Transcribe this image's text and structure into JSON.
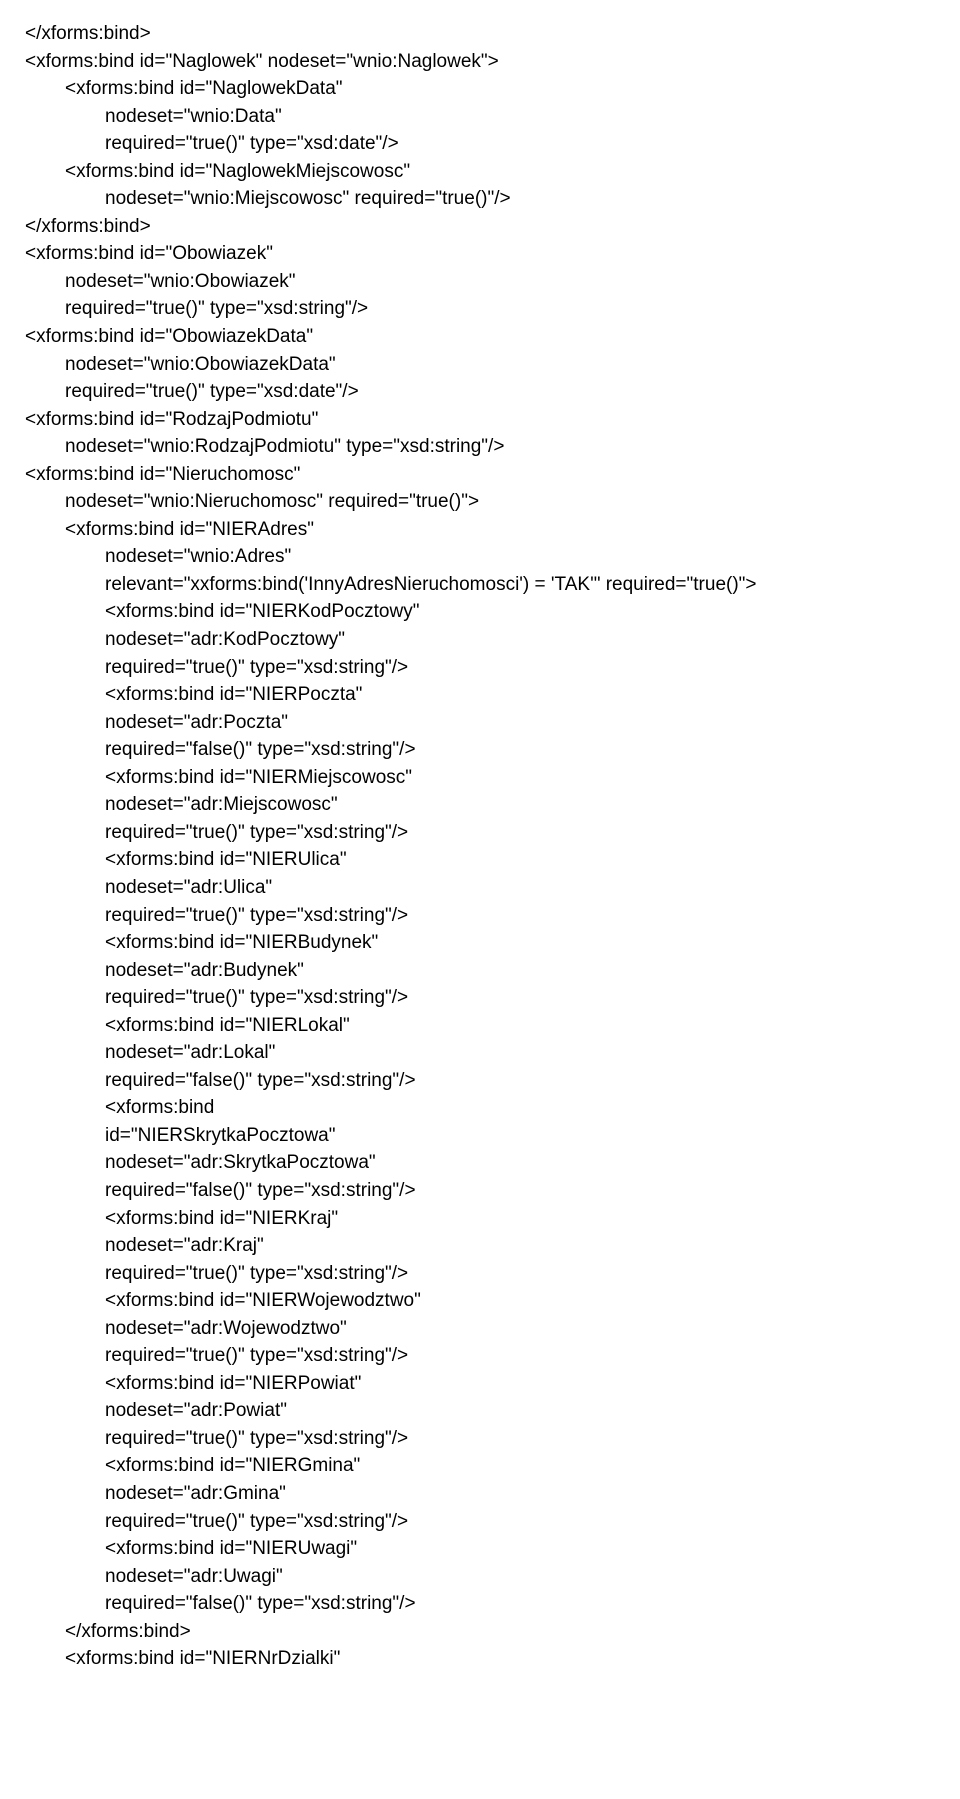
{
  "lines": [
    {
      "indent": 0,
      "text": "</xforms:bind>"
    },
    {
      "indent": 0,
      "text": "<xforms:bind id=\"Naglowek\" nodeset=\"wnio:Naglowek\">"
    },
    {
      "indent": 1,
      "text": "<xforms:bind id=\"NaglowekData\""
    },
    {
      "indent": 2,
      "text": "nodeset=\"wnio:Data\""
    },
    {
      "indent": 2,
      "text": "required=\"true()\" type=\"xsd:date\"/>"
    },
    {
      "indent": 1,
      "text": "<xforms:bind id=\"NaglowekMiejscowosc\""
    },
    {
      "indent": 2,
      "text": "nodeset=\"wnio:Miejscowosc\" required=\"true()\"/>"
    },
    {
      "indent": 0,
      "text": "</xforms:bind>"
    },
    {
      "indent": 0,
      "text": "<xforms:bind id=\"Obowiazek\""
    },
    {
      "indent": 1,
      "text": "nodeset=\"wnio:Obowiazek\""
    },
    {
      "indent": 1,
      "text": "required=\"true()\" type=\"xsd:string\"/>"
    },
    {
      "indent": 0,
      "text": "<xforms:bind id=\"ObowiazekData\""
    },
    {
      "indent": 1,
      "text": "nodeset=\"wnio:ObowiazekData\""
    },
    {
      "indent": 1,
      "text": "required=\"true()\" type=\"xsd:date\"/>"
    },
    {
      "indent": 0,
      "text": "<xforms:bind id=\"RodzajPodmiotu\""
    },
    {
      "indent": 1,
      "text": "nodeset=\"wnio:RodzajPodmiotu\" type=\"xsd:string\"/>"
    },
    {
      "indent": 0,
      "text": "<xforms:bind id=\"Nieruchomosc\""
    },
    {
      "indent": 1,
      "text": "nodeset=\"wnio:Nieruchomosc\" required=\"true()\">"
    },
    {
      "indent": 1,
      "text": "<xforms:bind id=\"NIERAdres\""
    },
    {
      "indent": 2,
      "text": "nodeset=\"wnio:Adres\""
    },
    {
      "indent": 2,
      "text": "relevant=\"xxforms:bind('InnyAdresNieruchomosci') = 'TAK'\" required=\"true()\">"
    },
    {
      "indent": 2,
      "text": "<xforms:bind id=\"NIERKodPocztowy\""
    },
    {
      "indent": 2,
      "text": "nodeset=\"adr:KodPocztowy\""
    },
    {
      "indent": 2,
      "text": "required=\"true()\" type=\"xsd:string\"/>"
    },
    {
      "indent": 2,
      "text": "<xforms:bind id=\"NIERPoczta\""
    },
    {
      "indent": 2,
      "text": "nodeset=\"adr:Poczta\""
    },
    {
      "indent": 2,
      "text": "required=\"false()\" type=\"xsd:string\"/>"
    },
    {
      "indent": 2,
      "text": "<xforms:bind id=\"NIERMiejscowosc\""
    },
    {
      "indent": 2,
      "text": "nodeset=\"adr:Miejscowosc\""
    },
    {
      "indent": 2,
      "text": "required=\"true()\" type=\"xsd:string\"/>"
    },
    {
      "indent": 2,
      "text": "<xforms:bind id=\"NIERUlica\""
    },
    {
      "indent": 2,
      "text": "nodeset=\"adr:Ulica\""
    },
    {
      "indent": 2,
      "text": "required=\"true()\" type=\"xsd:string\"/>"
    },
    {
      "indent": 2,
      "text": "<xforms:bind id=\"NIERBudynek\""
    },
    {
      "indent": 2,
      "text": "nodeset=\"adr:Budynek\""
    },
    {
      "indent": 2,
      "text": "required=\"true()\" type=\"xsd:string\"/>"
    },
    {
      "indent": 2,
      "text": "<xforms:bind id=\"NIERLokal\""
    },
    {
      "indent": 2,
      "text": "nodeset=\"adr:Lokal\""
    },
    {
      "indent": 2,
      "text": "required=\"false()\" type=\"xsd:string\"/>"
    },
    {
      "indent": 2,
      "text": "<xforms:bind"
    },
    {
      "indent": 2,
      "text": "id=\"NIERSkrytkaPocztowa\""
    },
    {
      "indent": 2,
      "text": "nodeset=\"adr:SkrytkaPocztowa\""
    },
    {
      "indent": 2,
      "text": "required=\"false()\" type=\"xsd:string\"/>"
    },
    {
      "indent": 2,
      "text": "<xforms:bind id=\"NIERKraj\""
    },
    {
      "indent": 2,
      "text": "nodeset=\"adr:Kraj\""
    },
    {
      "indent": 2,
      "text": "required=\"true()\" type=\"xsd:string\"/>"
    },
    {
      "indent": 2,
      "text": "<xforms:bind id=\"NIERWojewodztwo\""
    },
    {
      "indent": 2,
      "text": "nodeset=\"adr:Wojewodztwo\""
    },
    {
      "indent": 2,
      "text": "required=\"true()\" type=\"xsd:string\"/>"
    },
    {
      "indent": 2,
      "text": "<xforms:bind id=\"NIERPowiat\""
    },
    {
      "indent": 2,
      "text": "nodeset=\"adr:Powiat\""
    },
    {
      "indent": 2,
      "text": "required=\"true()\" type=\"xsd:string\"/>"
    },
    {
      "indent": 2,
      "text": "<xforms:bind id=\"NIERGmina\""
    },
    {
      "indent": 2,
      "text": "nodeset=\"adr:Gmina\""
    },
    {
      "indent": 2,
      "text": "required=\"true()\" type=\"xsd:string\"/>"
    },
    {
      "indent": 2,
      "text": "<xforms:bind id=\"NIERUwagi\""
    },
    {
      "indent": 2,
      "text": "nodeset=\"adr:Uwagi\""
    },
    {
      "indent": 2,
      "text": "required=\"false()\" type=\"xsd:string\"/>"
    },
    {
      "indent": 1,
      "text": "</xforms:bind>"
    },
    {
      "indent": 1,
      "text": "<xforms:bind id=\"NIERNrDzialki\""
    }
  ]
}
